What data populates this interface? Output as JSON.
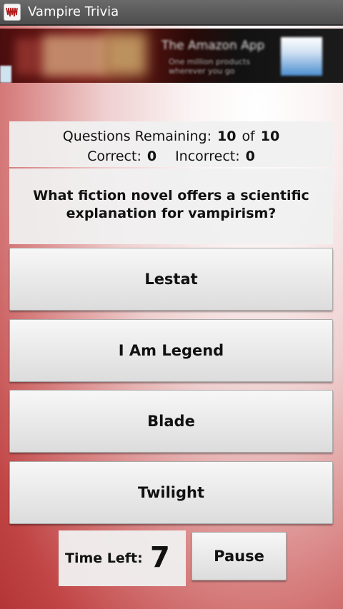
{
  "app": {
    "title": "Vampire Trivia",
    "icon": "vampire-trivia-app-icon"
  },
  "ad_banner": {
    "headline": "The Amazon App",
    "subtext_line1": "One million products",
    "subtext_line2": "wherever you go"
  },
  "status": {
    "remaining_label": "Questions Remaining:",
    "remaining_value": "10",
    "of_label": "of",
    "total_value": "10",
    "correct_label": "Correct:",
    "correct_value": "0",
    "incorrect_label": "Incorrect:",
    "incorrect_value": "0"
  },
  "question": {
    "text": "What fiction novel offers a scientific explanation for vampirism?"
  },
  "answers": [
    {
      "label": "Lestat"
    },
    {
      "label": "I Am Legend"
    },
    {
      "label": "Blade"
    },
    {
      "label": "Twilight"
    }
  ],
  "timer": {
    "label": "Time Left:",
    "value": "7"
  },
  "controls": {
    "pause_label": "Pause"
  },
  "colors": {
    "title_bar": "#4d4d4d",
    "background_red": "#b43535",
    "panel": "#f0f0f0",
    "button_text": "#111111"
  }
}
